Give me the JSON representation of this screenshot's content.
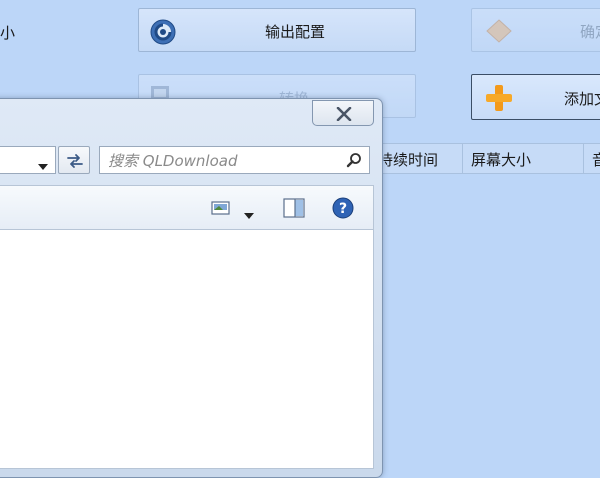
{
  "app": {
    "side_label": "小",
    "buttons": {
      "output_config": "输出配置",
      "disabled": "确定",
      "faded": "转换",
      "add_file": "添加文"
    },
    "columns": [
      "持续时间",
      "屏幕大小",
      "音"
    ]
  },
  "dialog": {
    "search_placeholder": "搜索 QLDownload"
  },
  "colors": {
    "background": "#bcd6f8",
    "dialog_frame": "#cad9ec",
    "add_icon": "#f39a1b"
  }
}
